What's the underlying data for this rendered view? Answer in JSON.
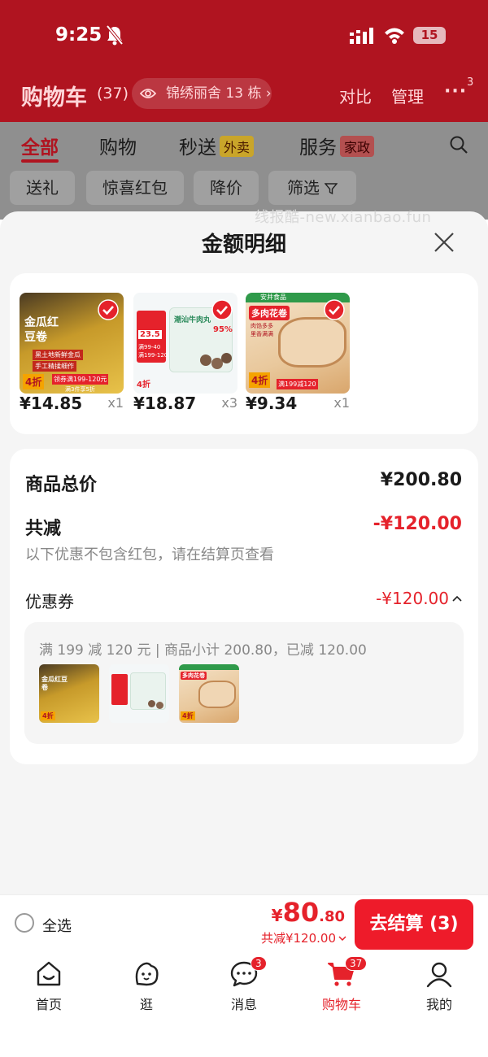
{
  "status_bar": {
    "time": "9:25",
    "battery": "15"
  },
  "header": {
    "title": "购物车",
    "count": "(37)",
    "address": "锦绣丽舍 13 栋",
    "compare": "对比",
    "manage": "管理",
    "more": "···",
    "more_badge": "3"
  },
  "tabs": [
    {
      "label": "全部"
    },
    {
      "label": "购物"
    },
    {
      "label": "秒送",
      "tag": "外卖"
    },
    {
      "label": "服务",
      "tag": "家政"
    }
  ],
  "filters": [
    "送礼",
    "惊喜红包",
    "降价",
    "筛选"
  ],
  "watermark": "线报酷-new.xianbao.fun",
  "sheet": {
    "title": "金额明细",
    "products": [
      {
        "price": "¥14.85",
        "qty": "x1",
        "img_text": "金瓜红豆卷",
        "img_promo": "领券满199-120元",
        "img_discount": "4折",
        "img_sub": "黑土地新鲜金瓜",
        "img_sub2": "手工精揉细作",
        "img_bottom": "满3件享5折"
      },
      {
        "price": "¥18.87",
        "qty": "x3",
        "img_text": "潮汕牛肉丸",
        "img_price": "23.5",
        "img_promo": "满99-40",
        "img_promo2": "满199-120",
        "img_discount": "4折",
        "img_sub": "95%"
      },
      {
        "price": "¥9.34",
        "qty": "x1",
        "img_brand": "安井食品",
        "img_text": "多肉花卷",
        "img_sub": "肉馅多多",
        "img_sub2": "里香满满",
        "img_promo": "满199减120",
        "img_discount": "4折"
      }
    ],
    "summary": {
      "total_label": "商品总价",
      "total_value": "¥200.80",
      "reduce_label": "共减",
      "reduce_value": "-¥120.00",
      "note": "以下优惠不包含红包，请在结算页查看",
      "coupon_label": "优惠券",
      "coupon_value": "-¥120.00",
      "coupon_desc": "满 199 减 120 元 | 商品小计 200.80，已减 120.00"
    }
  },
  "bottom_bar": {
    "select_all": "全选",
    "price_yen": "¥",
    "price_int": "80",
    "price_dec": ".80",
    "discount": "共减¥120.00",
    "checkout": "去结算 (3)"
  },
  "tabbar": [
    {
      "label": "首页",
      "icon": "home-icon"
    },
    {
      "label": "逛",
      "icon": "browse-icon"
    },
    {
      "label": "消息",
      "icon": "message-icon",
      "badge": "3"
    },
    {
      "label": "购物车",
      "icon": "cart-icon",
      "badge": "37"
    },
    {
      "label": "我的",
      "icon": "profile-icon"
    }
  ],
  "colors": {
    "brand_red": "#e5222b",
    "checkout_red": "#ee1b2a",
    "header_dim_red": "#b01420"
  }
}
